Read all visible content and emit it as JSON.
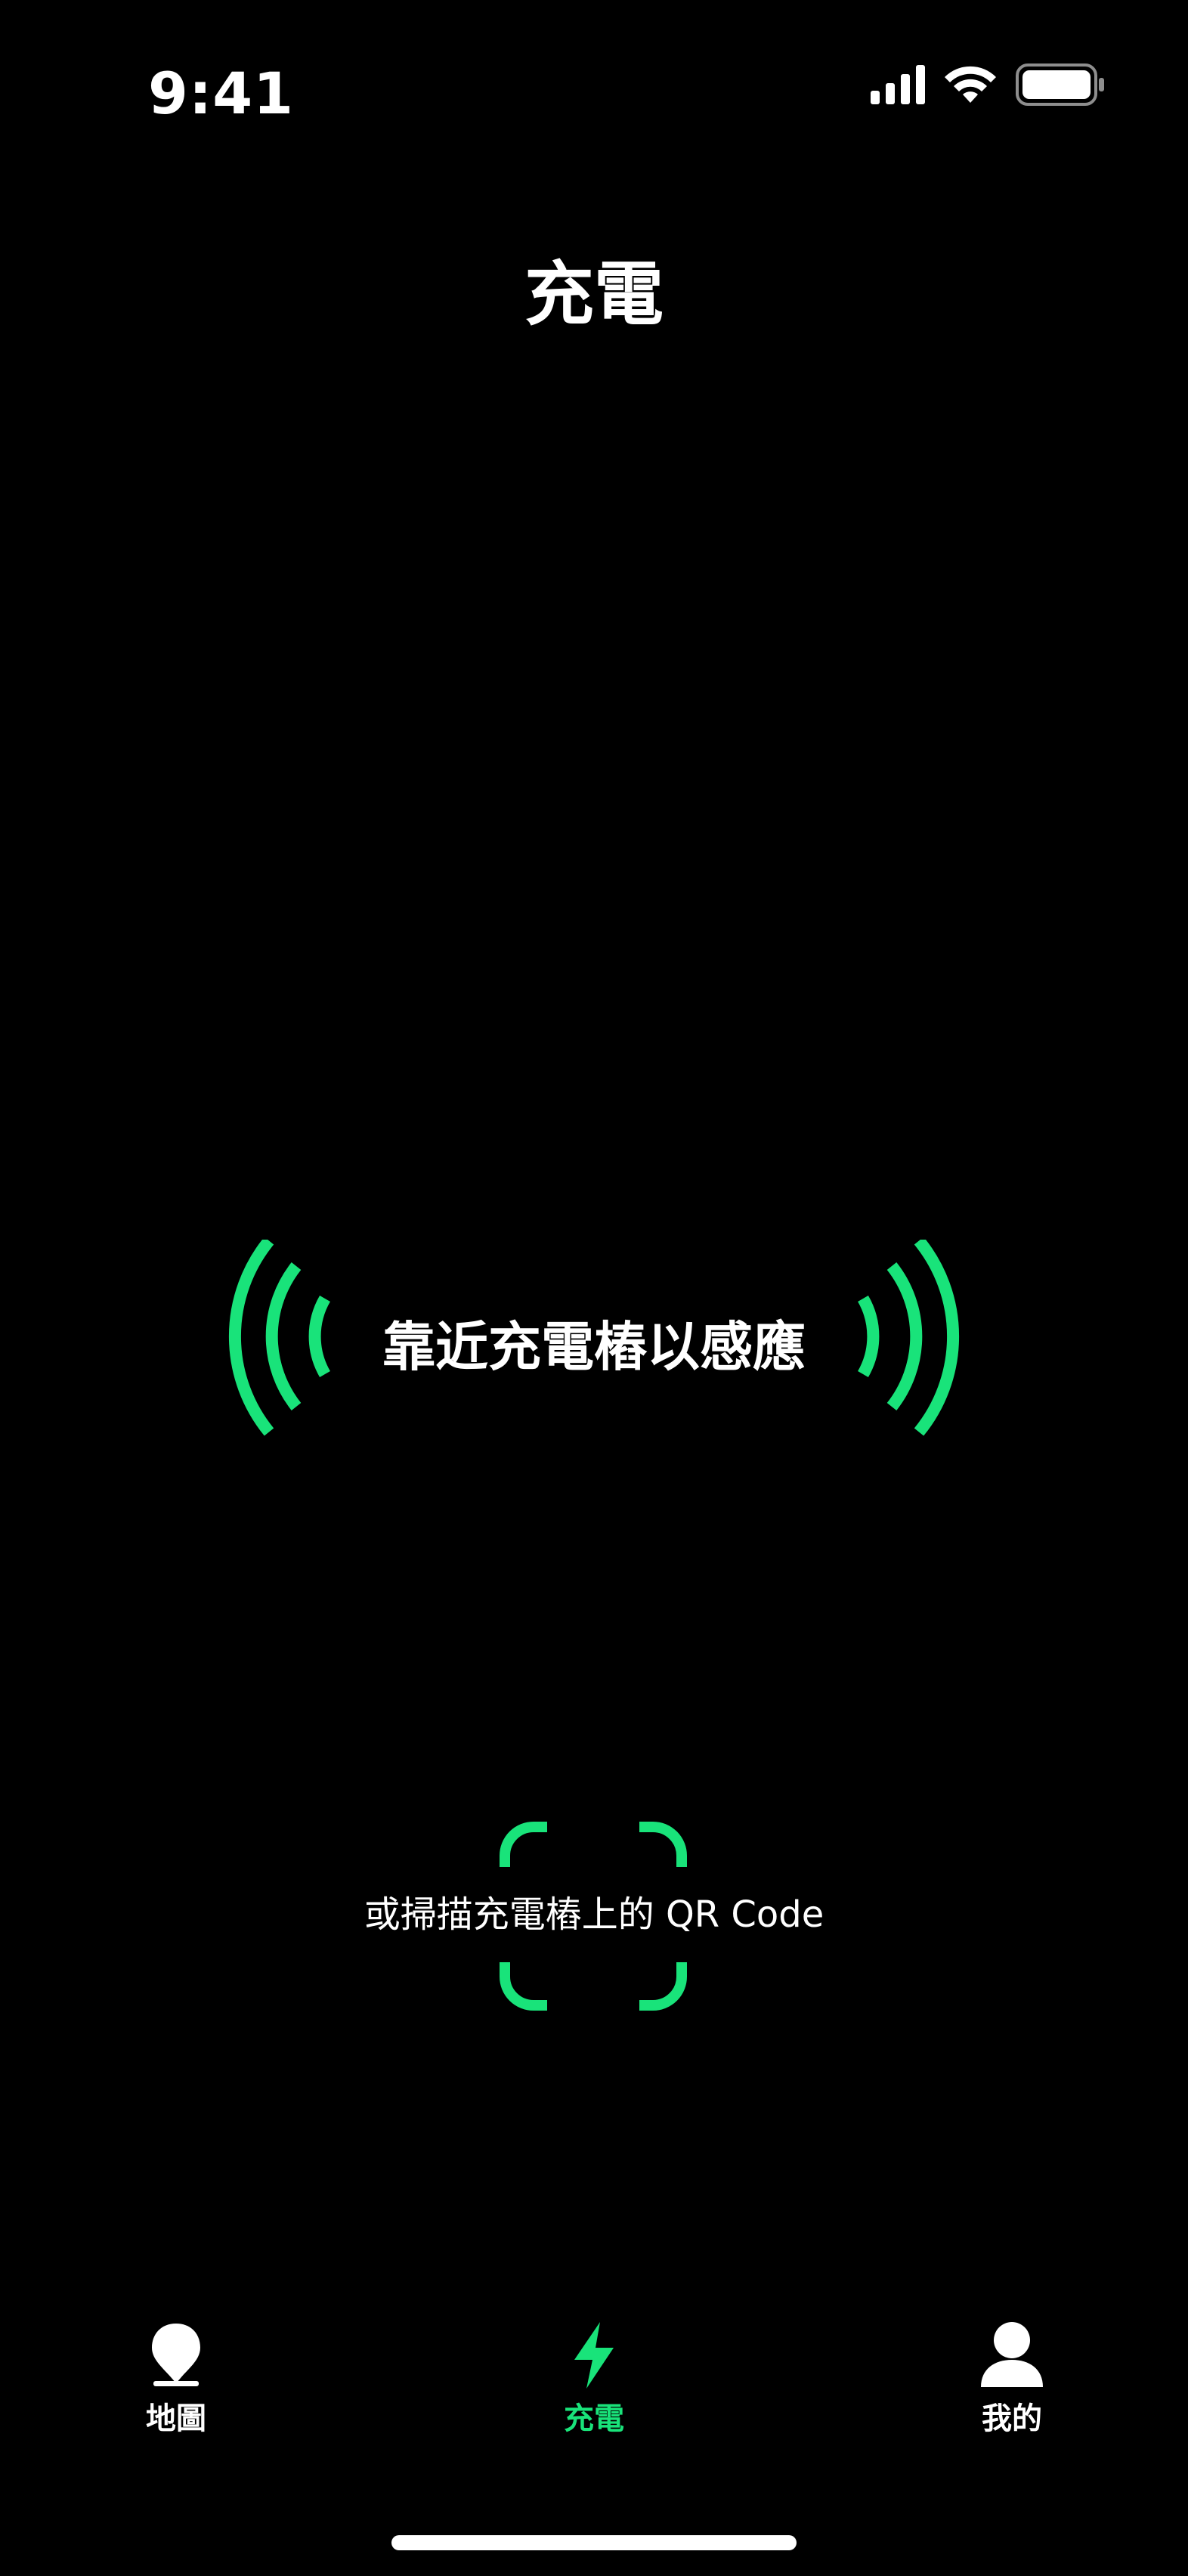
{
  "status_bar": {
    "time": "9:41"
  },
  "header": {
    "title": "充電"
  },
  "nfc": {
    "prompt": "靠近充電樁以感應",
    "icon": "nfc-wave-icon",
    "accent_color": "#19e37a"
  },
  "qr": {
    "prompt": "或掃描充電樁上的 QR Code",
    "icon": "qr-scan-frame-icon"
  },
  "tab_bar": {
    "active_tab": "charge",
    "active_color": "#19e37a",
    "inactive_color": "#ffffff",
    "tabs": [
      {
        "id": "map",
        "label": "地圖",
        "icon": "map-pin-icon"
      },
      {
        "id": "charge",
        "label": "充電",
        "icon": "lightning-bolt-icon"
      },
      {
        "id": "mine",
        "label": "我的",
        "icon": "person-icon"
      }
    ]
  }
}
